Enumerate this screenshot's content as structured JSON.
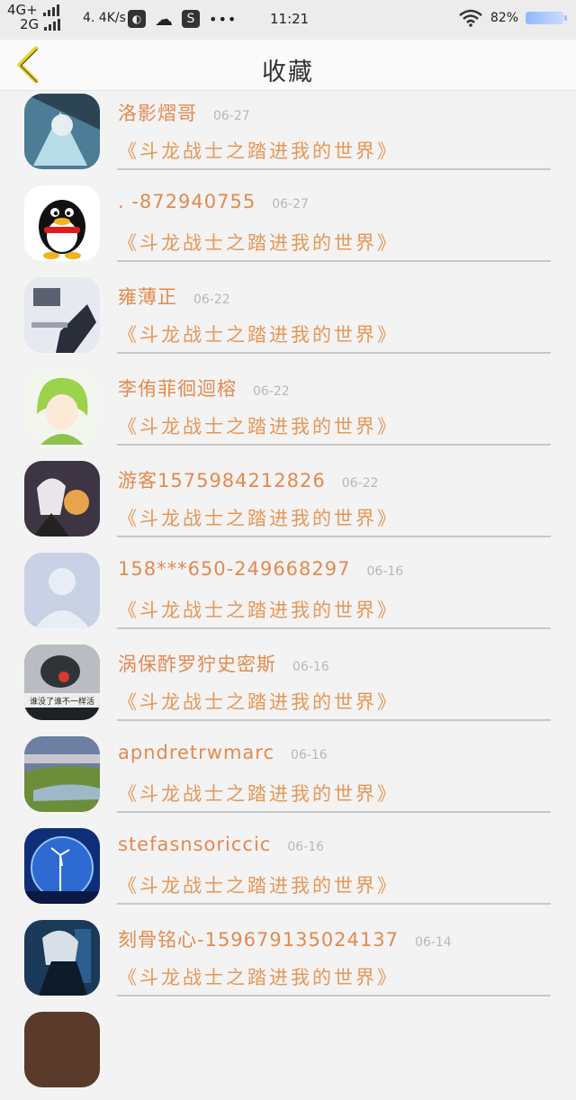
{
  "status_bar": {
    "network1": "4G+",
    "network2": "2G",
    "speed": "4. 4K/s",
    "time": "11:21",
    "battery": "82%",
    "icons": [
      "message-app-icon",
      "wechat-icon",
      "s-app-icon",
      "more-dots-icon"
    ]
  },
  "header": {
    "title": "收藏",
    "back_icon": "chevron-left-icon"
  },
  "colors": {
    "accent": "#e38a4f",
    "back_arrow": "#e9cf2d",
    "date": "#b8b8b8",
    "divider": "#c8c8c8"
  },
  "favorites": [
    {
      "name": "洛影熠哥",
      "date": "06-27",
      "book": "《斗龙战士之踏进我的世界》",
      "avatar": "anime-warrior-avatar"
    },
    {
      "name": ". -872940755",
      "date": "06-27",
      "book": "《斗龙战士之踏进我的世界》",
      "avatar": "qq-penguin-avatar"
    },
    {
      "name": "雍薄正",
      "date": "06-22",
      "book": "《斗龙战士之踏进我的世界》",
      "avatar": "desk-scene-avatar"
    },
    {
      "name": "李侑菲徊迴榕",
      "date": "06-22",
      "book": "《斗龙战士之踏进我的世界》",
      "avatar": "green-hair-girl-avatar"
    },
    {
      "name": "游客1575984212826",
      "date": "06-22",
      "book": "《斗龙战士之踏进我的世界》",
      "avatar": "white-hair-anime-avatar"
    },
    {
      "name": "158***650-249668297",
      "date": "06-16",
      "book": "《斗龙战士之踏进我的世界》",
      "avatar": "default-user-avatar"
    },
    {
      "name": "涡保酢罗狞史密斯",
      "date": "06-16",
      "book": "《斗龙战士之踏进我的世界》",
      "avatar": "sad-girl-text-avatar",
      "avatar_text": "谁没了谁不一样活"
    },
    {
      "name": "apndretrwmarc",
      "date": "06-16",
      "book": "《斗龙战士之踏进我的世界》",
      "avatar": "landscape-avatar"
    },
    {
      "name": "stefasnsoriccic",
      "date": "06-16",
      "book": "《斗龙战士之踏进我的世界》",
      "avatar": "globe-windmill-avatar"
    },
    {
      "name": "刻骨铭心-159679135024137",
      "date": "06-14",
      "book": "《斗龙战士之踏进我的世界》",
      "avatar": "dark-anime-boy-avatar"
    }
  ]
}
